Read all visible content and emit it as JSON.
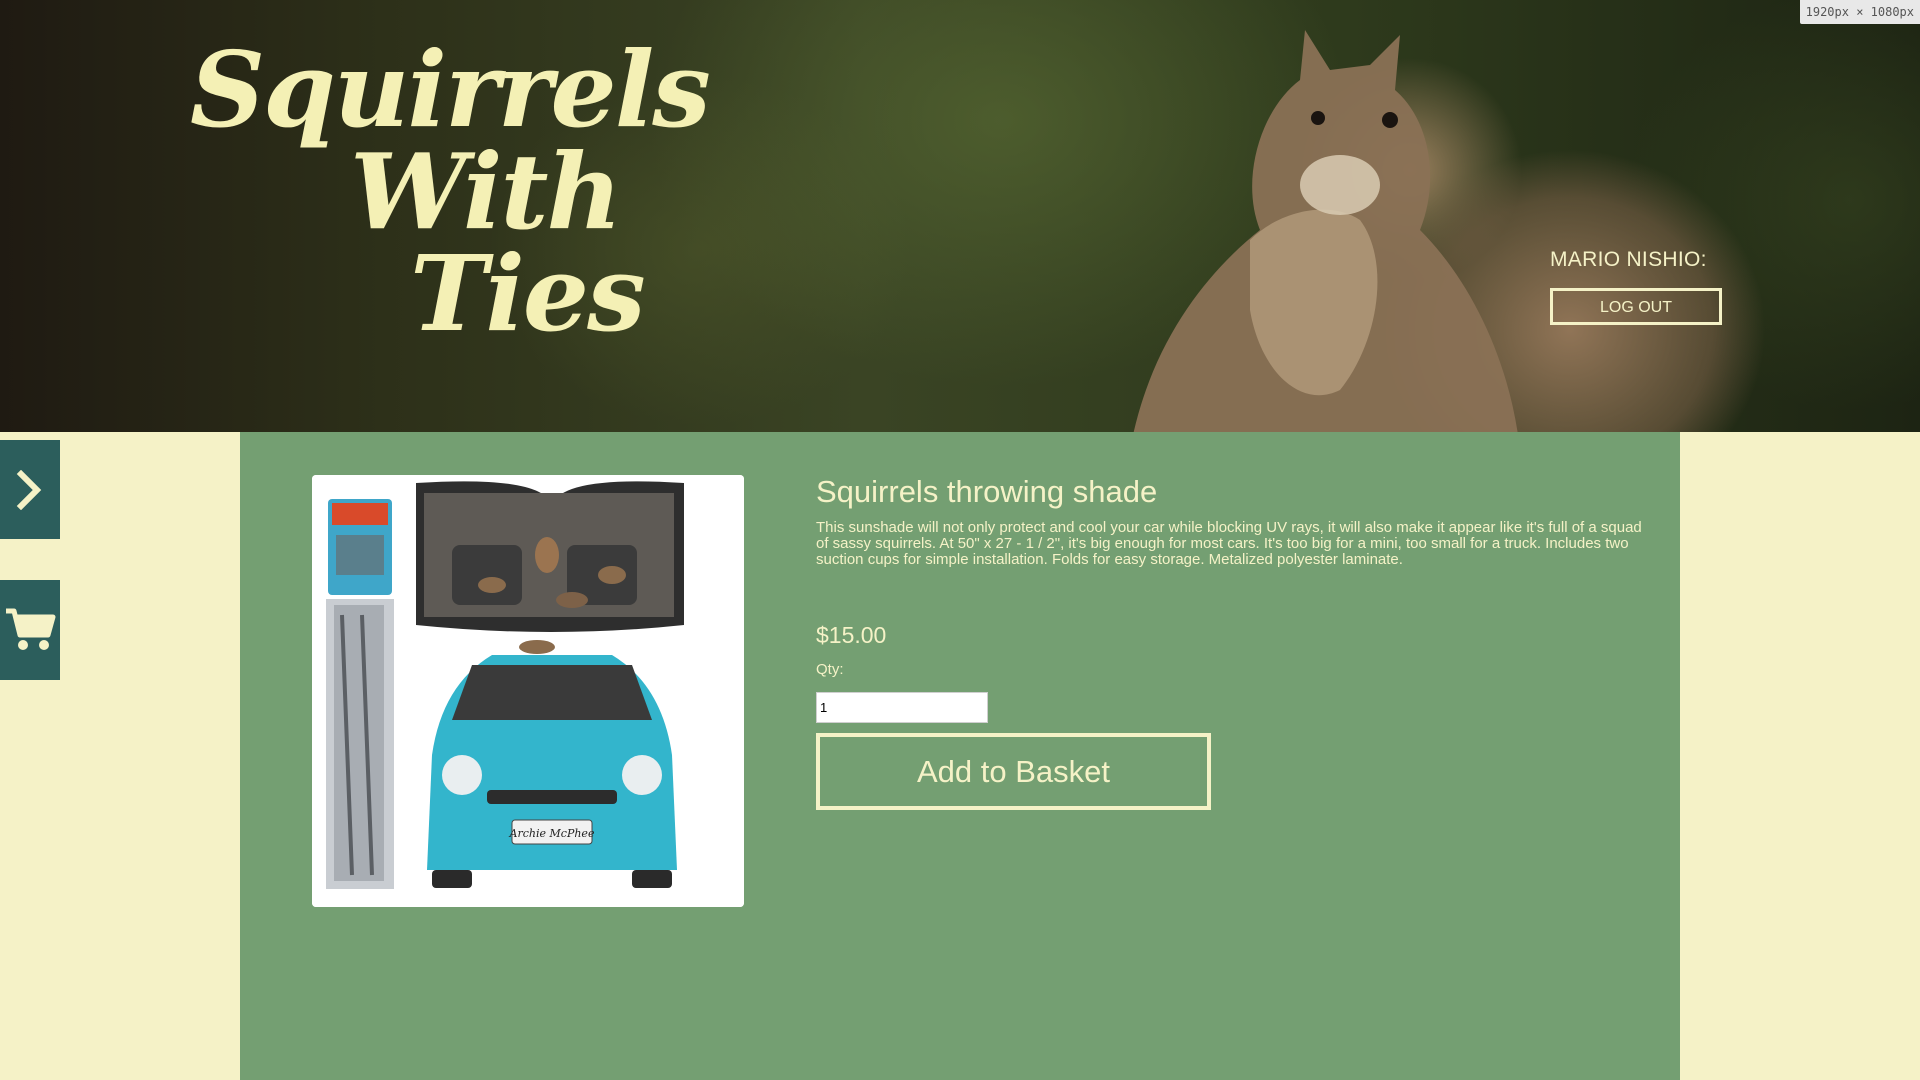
{
  "header": {
    "logo_line1": "Squirrels",
    "logo_line2": "With",
    "logo_line3": "Ties",
    "user_name": "MARIO NISHIO:",
    "logout_label": "LOG OUT"
  },
  "sidebar": {
    "expand_icon": "chevron-right-icon",
    "cart_icon": "cart-icon"
  },
  "product": {
    "title": "Squirrels throwing shade",
    "description": "This sunshade will not only protect and cool your car while blocking UV rays, it will also make it appear like it's full of a squad of sassy squirrels. At 50\" x 27 - 1 / 2\", it's big enough for most cars. It's too big for a mini, too small for a truck. Includes two suction cups for simple installation. Folds for easy storage. Metalized polyester laminate.",
    "price": "$15.00",
    "qty_label": "Qty:",
    "qty_value": "1",
    "add_button_label": "Add to Basket",
    "image_label": "Archie McPhee"
  },
  "overlay": {
    "resolution_badge": "1920px × 1080px"
  },
  "colors": {
    "cream": "#f5f2c7",
    "panel_green": "#749f72",
    "side_teal": "#2c5e5c"
  }
}
